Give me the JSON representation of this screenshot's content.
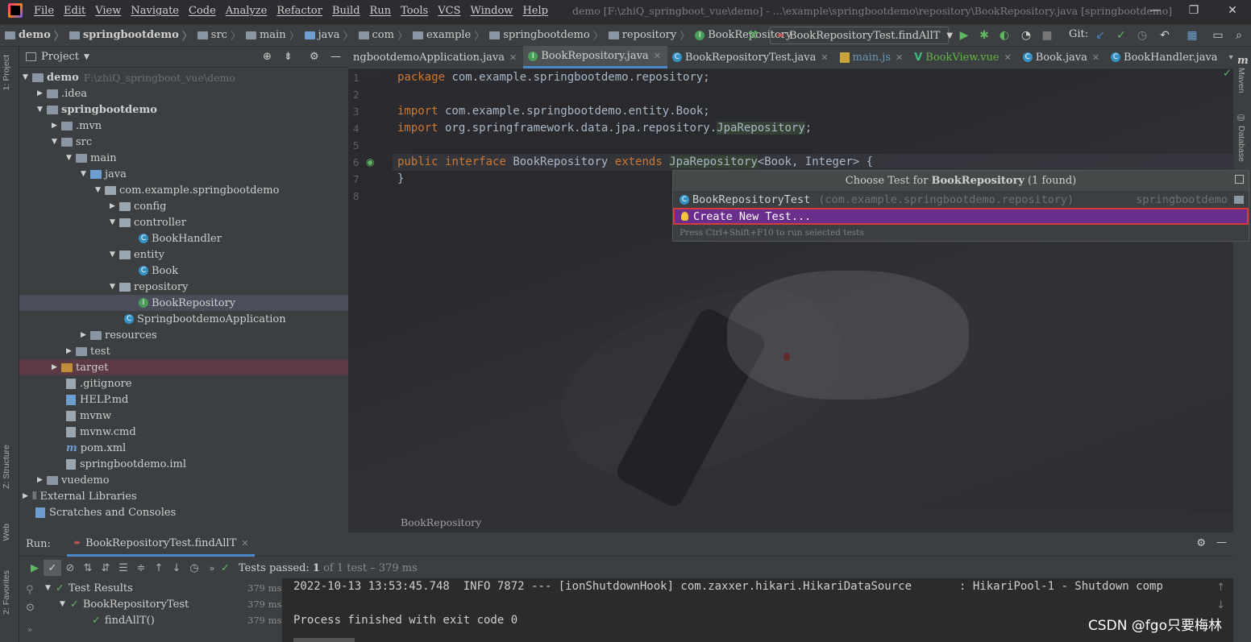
{
  "menu": [
    "File",
    "Edit",
    "View",
    "Navigate",
    "Code",
    "Analyze",
    "Refactor",
    "Build",
    "Run",
    "Tools",
    "VCS",
    "Window",
    "Help"
  ],
  "window_title": "demo [F:\\zhiQ_springboot_vue\\demo] - ...\\example\\springbootdemo\\repository\\BookRepository.java [springbootdemo]",
  "breadcrumbs": [
    "demo",
    "springbootdemo",
    "src",
    "main",
    "java",
    "com",
    "example",
    "springbootdemo",
    "repository",
    "BookRepository"
  ],
  "run_config": "BookRepositoryTest.findAllT",
  "git_label": "Git:",
  "project_panel": {
    "title": "Project",
    "tree": [
      {
        "label": "demo",
        "hint": "F:\\zhiQ_springboot_vue\\demo",
        "bold": true
      },
      {
        "label": ".idea"
      },
      {
        "label": "springbootdemo",
        "bold": true
      },
      {
        "label": ".mvn"
      },
      {
        "label": "src"
      },
      {
        "label": "main"
      },
      {
        "label": "java"
      },
      {
        "label": "com.example.springbootdemo"
      },
      {
        "label": "config"
      },
      {
        "label": "controller"
      },
      {
        "label": "BookHandler"
      },
      {
        "label": "entity"
      },
      {
        "label": "Book"
      },
      {
        "label": "repository"
      },
      {
        "label": "BookRepository"
      },
      {
        "label": "SpringbootdemoApplication"
      },
      {
        "label": "resources"
      },
      {
        "label": "test"
      },
      {
        "label": "target"
      },
      {
        "label": ".gitignore"
      },
      {
        "label": "HELP.md"
      },
      {
        "label": "mvnw"
      },
      {
        "label": "mvnw.cmd"
      },
      {
        "label": "pom.xml"
      },
      {
        "label": "springbootdemo.iml"
      },
      {
        "label": "vuedemo"
      },
      {
        "label": "External Libraries"
      },
      {
        "label": "Scratches and Consoles"
      }
    ]
  },
  "left_strip": {
    "project": "1: Project",
    "structure": "Z: Structure",
    "web": "Web",
    "favorites": "2: Favorites"
  },
  "right_strip": {
    "maven": "Maven",
    "database": "Database"
  },
  "tabs": [
    "ngbootdemoApplication.java",
    "BookRepository.java",
    "BookRepositoryTest.java",
    "main.js",
    "BookView.vue",
    "Book.java",
    "BookHandler.java"
  ],
  "tabs_overflow": "3",
  "editor": {
    "line_numbers": [
      "1",
      "2",
      "3",
      "4",
      "5",
      "6",
      "7",
      "8"
    ],
    "lines": {
      "l1_kw": "package",
      "l1_rest": " com.example.springbootdemo.repository;",
      "l3_kw": "import",
      "l3_rest": " com.example.springbootdemo.entity.Book;",
      "l4_kw": "import",
      "l4_rest": " org.springframework.data.jpa.repository.",
      "l4_hl": "JpaRepository",
      "l4_end": ";",
      "l6_kw1": "public",
      "l6_kw2": "interface",
      "l6_name": "BookRepository",
      "l6_kw3": "extends",
      "l6_super": "JpaRepository",
      "l6_rest": "<Book, Integer> {",
      "l7": "}"
    },
    "bottom_breadcrumb": "BookRepository"
  },
  "popup": {
    "title_prefix": "Choose Test for ",
    "title_bold": "BookRepository",
    "title_suffix": " (1 found)",
    "item_name": "BookRepositoryTest",
    "item_pkg": "(com.example.springbootdemo.repository)",
    "item_module": "springbootdemo",
    "create_label": "Create New Test...",
    "footer": "Press Ctrl+Shift+F10 to run selected tests"
  },
  "run_panel": {
    "label": "Run:",
    "tab": "BookRepositoryTest.findAllT",
    "passed_prefix": "Tests passed: ",
    "passed_count": "1",
    "passed_suffix": " of 1 test – 379 ms",
    "results": [
      {
        "label": "Test Results",
        "ms": "379 ms"
      },
      {
        "label": "BookRepositoryTest",
        "ms": "379 ms"
      },
      {
        "label": "findAllT()",
        "ms": "379 ms"
      }
    ],
    "console": [
      "2022-10-13 13:53:45.748  INFO 7872 --- [ionShutdownHook] com.zaxxer.hikari.HikariDataSource       : HikariPool-1 - Shutdown comp",
      "Process finished with exit code 0"
    ]
  },
  "watermark": "CSDN @fgo只要梅林",
  "colors": {
    "accent": "#4a88c7",
    "popup_selected": "#6a2e8c",
    "popup_border": "#d73b3b",
    "keyword": "#cc7832"
  }
}
